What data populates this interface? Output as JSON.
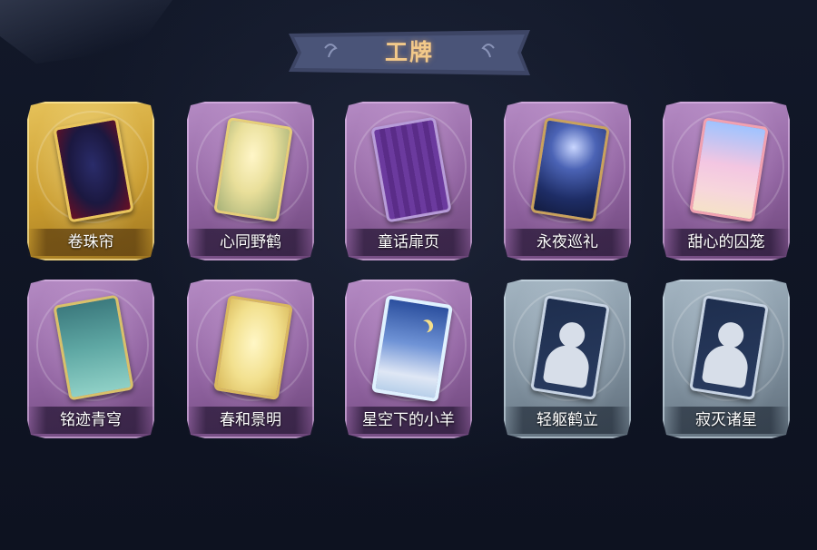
{
  "title": "工牌",
  "cards": [
    {
      "name": "卷珠帘",
      "rarity": "gold",
      "art": "pearl"
    },
    {
      "name": "心同野鹤",
      "rarity": "purple",
      "art": "crane"
    },
    {
      "name": "童话扉页",
      "rarity": "purple",
      "art": "fairy"
    },
    {
      "name": "永夜巡礼",
      "rarity": "purple",
      "art": "night"
    },
    {
      "name": "甜心的囚笼",
      "rarity": "purple",
      "art": "cage"
    },
    {
      "name": "铭迹青穹",
      "rarity": "purple",
      "art": "teal"
    },
    {
      "name": "春和景明",
      "rarity": "purple",
      "art": "spring"
    },
    {
      "name": "星空下的小羊",
      "rarity": "purple",
      "art": "sheep"
    },
    {
      "name": "轻躯鹤立",
      "rarity": "grey",
      "art": "silhouette"
    },
    {
      "name": "寂灭诸星",
      "rarity": "grey",
      "art": "silhouette"
    }
  ],
  "colors": {
    "background": "#0e1322",
    "title_text": "#f3c98a",
    "banner": "#3d4565",
    "gold_frame": "#c99b2e",
    "purple_frame": "#8f629f",
    "grey_frame": "#7f909e"
  }
}
